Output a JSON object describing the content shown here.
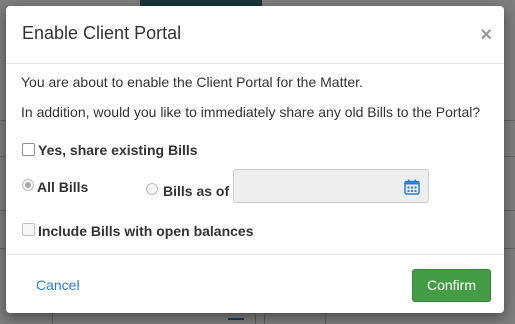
{
  "modal": {
    "title": "Enable Client Portal",
    "close_glyph": "×",
    "intro_text": "You are about to enable the Client Portal for the Matter.",
    "question_text": "In addition, would you like to immediately share any old Bills to the Portal?",
    "share_existing_label": "Yes, share existing Bills",
    "share_existing_checked": false,
    "all_bills_label": "All Bills",
    "bills_as_of_label": "Bills as of",
    "selected_option": "All Bills",
    "date_value": "",
    "date_icon": "calendar-icon",
    "include_open_label": "Include Bills with open balances",
    "include_open_checked": false,
    "cancel_label": "Cancel",
    "confirm_label": "Confirm"
  },
  "colors": {
    "confirm_bg": "#449d44",
    "link": "#2a7fd1",
    "header_bar": "#2e6f78"
  }
}
